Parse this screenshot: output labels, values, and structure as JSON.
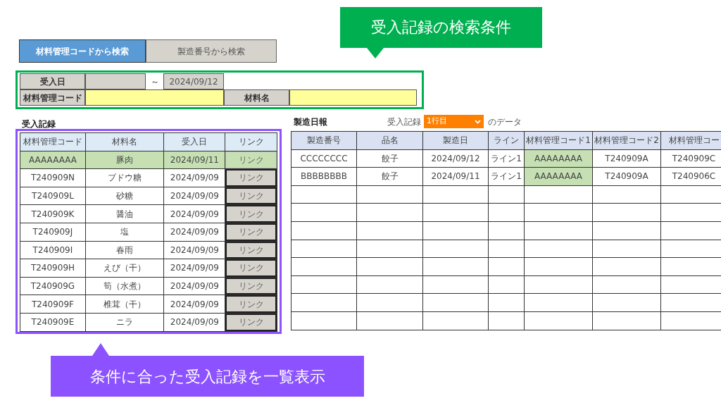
{
  "search_tabs": [
    {
      "label": "材料管理コードから検索",
      "selected": true
    },
    {
      "label": "製造番号から検索",
      "selected": false
    }
  ],
  "filters": {
    "date_label": "受入日",
    "date_separator": "～",
    "date_to": "2024/09/12",
    "code_label": "材料管理コード",
    "name_label": "材料名"
  },
  "receipts": {
    "title": "受入記録",
    "columns": [
      "材料管理コード",
      "材料名",
      "受入日",
      "リンク"
    ],
    "rows": [
      {
        "code": "AAAAAAAA",
        "name": "豚肉",
        "date": "2024/09/11",
        "link": "リンク",
        "selected": true
      },
      {
        "code": "T240909N",
        "name": "ブドウ糖",
        "date": "2024/09/09",
        "link": "リンク",
        "selected": false
      },
      {
        "code": "T240909L",
        "name": "砂糖",
        "date": "2024/09/09",
        "link": "リンク",
        "selected": false
      },
      {
        "code": "T240909K",
        "name": "醤油",
        "date": "2024/09/09",
        "link": "リンク",
        "selected": false
      },
      {
        "code": "T240909J",
        "name": "塩",
        "date": "2024/09/09",
        "link": "リンク",
        "selected": false
      },
      {
        "code": "T240909I",
        "name": "春雨",
        "date": "2024/09/09",
        "link": "リンク",
        "selected": false
      },
      {
        "code": "T240909H",
        "name": "えび（干）",
        "date": "2024/09/09",
        "link": "リンク",
        "selected": false
      },
      {
        "code": "T240909G",
        "name": "筍（水煮）",
        "date": "2024/09/09",
        "link": "リンク",
        "selected": false
      },
      {
        "code": "T240909F",
        "name": "椎茸（干）",
        "date": "2024/09/09",
        "link": "リンク",
        "selected": false
      },
      {
        "code": "T240909E",
        "name": "ニラ",
        "date": "2024/09/09",
        "link": "リンク",
        "selected": false
      }
    ]
  },
  "production": {
    "title": "製造日報",
    "picker_label": "受入記録",
    "picker_value": "1行目",
    "picker_suffix": "のデータ",
    "columns": [
      "製造番号",
      "品名",
      "製造日",
      "ライン",
      "材料管理コード1",
      "材料管理コード2",
      "材料管理コー"
    ],
    "rows": [
      {
        "cells": [
          {
            "text": "CCCCCCCC",
            "highlighted": false
          },
          {
            "text": "餃子",
            "highlighted": false
          },
          {
            "text": "2024/09/12",
            "highlighted": false
          },
          {
            "text": "ライン1",
            "highlighted": false
          },
          {
            "text": "AAAAAAAA",
            "highlighted": true
          },
          {
            "text": "T240909A",
            "highlighted": false
          },
          {
            "text": "T240909C",
            "highlighted": false
          }
        ]
      },
      {
        "cells": [
          {
            "text": "BBBBBBBB",
            "highlighted": false
          },
          {
            "text": "餃子",
            "highlighted": false
          },
          {
            "text": "2024/09/11",
            "highlighted": false
          },
          {
            "text": "ライン1",
            "highlighted": false
          },
          {
            "text": "AAAAAAAA",
            "highlighted": true
          },
          {
            "text": "T240909A",
            "highlighted": false
          },
          {
            "text": "T240906C",
            "highlighted": false
          }
        ]
      }
    ]
  },
  "callouts": [
    {
      "text": "受入記録の検索条件",
      "color": "#00b050"
    },
    {
      "text": "条件に合った受入記録を一覧表示",
      "color": "#8c52ff"
    }
  ]
}
